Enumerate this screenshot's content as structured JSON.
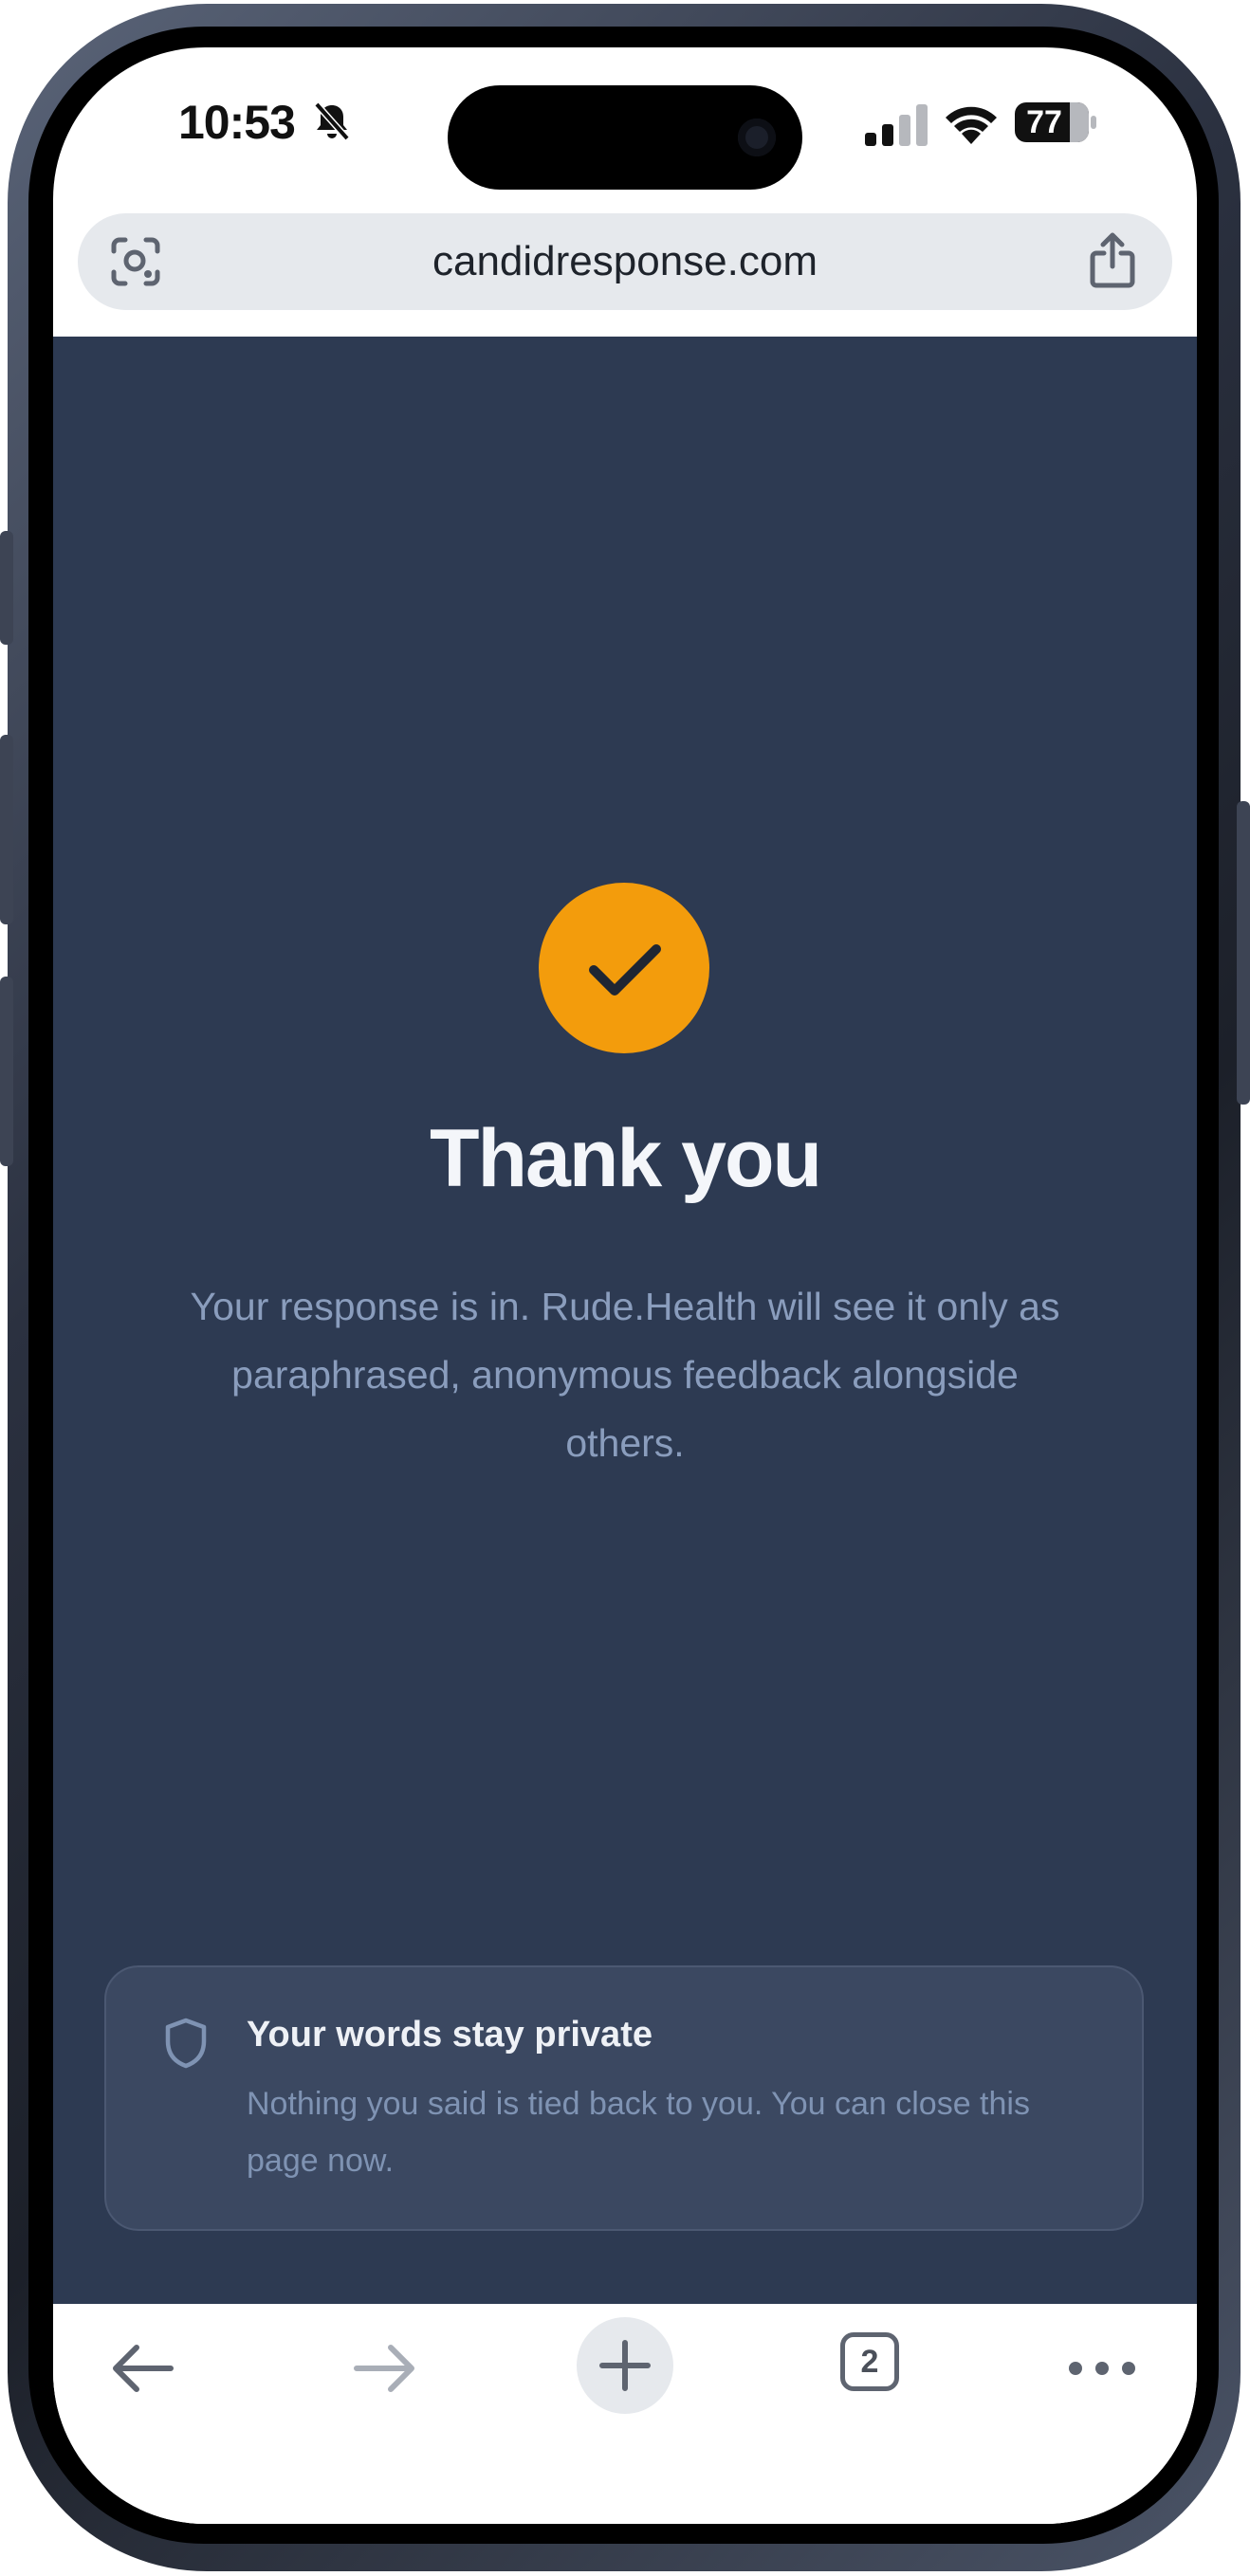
{
  "status_bar": {
    "time": "10:53",
    "battery": "77"
  },
  "browser": {
    "url": "candidresponse.com"
  },
  "confirmation": {
    "title": "Thank you",
    "message": "Your response is in. Rude.Health will see it only as paraphrased, anonymous feedback alongside others."
  },
  "privacy": {
    "title": "Your words stay private",
    "text": "Nothing you said is tied back to you. You can close this page now."
  },
  "toolbar": {
    "tab_count": "2"
  },
  "colors": {
    "page_bg": "#2d3a52",
    "accent": "#f39c0c",
    "card_bg": "#3b4861"
  }
}
